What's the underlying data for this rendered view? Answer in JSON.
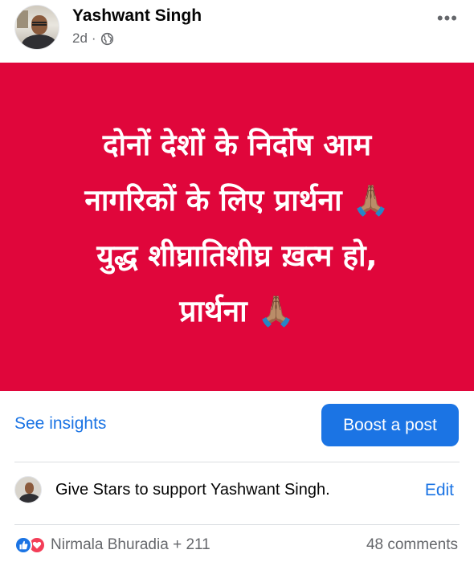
{
  "post": {
    "author": "Yashwant Singh",
    "time": "2d",
    "separator": "·",
    "privacy_icon": "globe-icon",
    "more_label": "•••"
  },
  "card": {
    "background": "#e0063b",
    "line1": "दोनों देशों के निर्दोष आम",
    "line2": "नागरिकों के लिए प्रार्थना 🙏🏽",
    "line3": "युद्ध शीघ्रातिशीघ्र ख़त्म हो,",
    "line4": "प्रार्थना 🙏🏽"
  },
  "actions": {
    "insights_label": "See insights",
    "boost_label": "Boost a post"
  },
  "stars": {
    "text": "Give Stars to support Yashwant Singh.",
    "edit_label": "Edit"
  },
  "engagement": {
    "reactions": [
      "like-icon",
      "love-icon"
    ],
    "names": "Nirmala Bhuradia + 211",
    "comments": "48 comments"
  },
  "colors": {
    "accent": "#1b74e4",
    "secondary_text": "#65676b",
    "love": "#f33e58"
  }
}
